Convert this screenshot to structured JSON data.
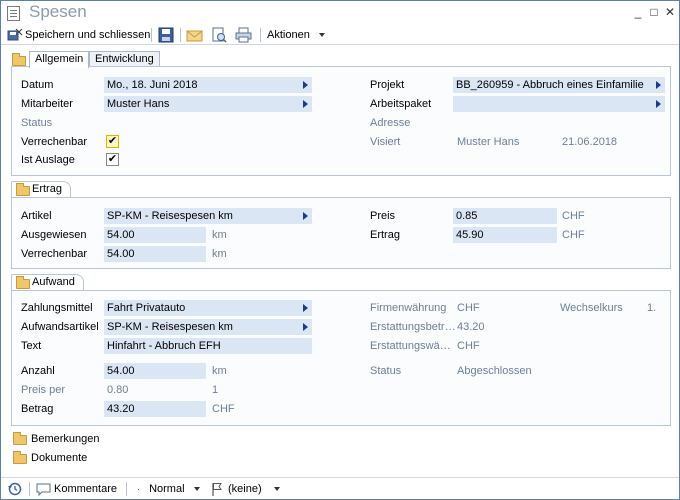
{
  "window": {
    "title": "Spesen",
    "minimize": "_",
    "maximize": "□",
    "close": "✕"
  },
  "toolbar": {
    "save_close_label": "Speichern und schliessen",
    "actions_label": "Aktionen"
  },
  "tabs": [
    {
      "label": "Allgemein",
      "active": true
    },
    {
      "label": "Entwicklung",
      "active": false
    }
  ],
  "allgemein": {
    "datum_label": "Datum",
    "datum_value": "Mo., 18. Juni 2018",
    "mitarbeiter_label": "Mitarbeiter",
    "mitarbeiter_value": "Muster Hans",
    "status_label": "Status",
    "verrechenbar_label": "Verrechenbar",
    "verrechenbar_checked": true,
    "ist_auslage_label": "Ist Auslage",
    "ist_auslage_checked": true,
    "projekt_label": "Projekt",
    "projekt_value": "BB_260959  -  Abbruch eines Einfamilie",
    "arbeitspaket_label": "Arbeitspaket",
    "arbeitspaket_value": "",
    "adresse_label": "Adresse",
    "visiert_label": "Visiert",
    "visiert_name": "Muster Hans",
    "visiert_date": "21.06.2018"
  },
  "ertrag": {
    "header": "Ertrag",
    "artikel_label": "Artikel",
    "artikel_value": "SP-KM  -  Reisespesen km",
    "ausgewiesen_label": "Ausgewiesen",
    "ausgewiesen_value": "54.00",
    "ausgewiesen_unit": "km",
    "verrechenbar_label": "Verrechenbar",
    "verrechenbar_value": "54.00",
    "verrechenbar_unit": "km",
    "preis_label": "Preis",
    "preis_value": "0.85",
    "preis_unit": "CHF",
    "ertrag_label": "Ertrag",
    "ertrag_value": "45.90",
    "ertrag_unit": "CHF"
  },
  "aufwand": {
    "header": "Aufwand",
    "zahlungsmittel_label": "Zahlungsmittel",
    "zahlungsmittel_value": "Fahrt Privatauto",
    "aufwandsartikel_label": "Aufwandsartikel",
    "aufwandsartikel_value": "SP-KM  -  Reisespesen km",
    "text_label": "Text",
    "text_value": "Hinfahrt - Abbruch EFH",
    "anzahl_label": "Anzahl",
    "anzahl_value": "54.00",
    "anzahl_unit": "km",
    "preis_per_label": "Preis per",
    "preis_per_value": "0.80",
    "preis_per_unit": "1",
    "betrag_label": "Betrag",
    "betrag_value": "43.20",
    "betrag_unit": "CHF",
    "firmenwaehrung_label": "Firmenwährung",
    "firmenwaehrung_value": "CHF",
    "wechselkurs_label": "Wechselkurs",
    "wechselkurs_value": "1.",
    "erstattungsbetrag_label": "Erstattungsbetr…",
    "erstattungsbetrag_value": "43.20",
    "erstattungswaehrung_label": "Erstattungswä…",
    "erstattungswaehrung_value": "CHF",
    "status_label": "Status",
    "status_value": "Abgeschlossen"
  },
  "sections": {
    "bemerkungen": "Bemerkungen",
    "dokumente": "Dokumente"
  },
  "statusbar": {
    "kommentare": "Kommentare",
    "priority": "Normal",
    "flag": "(keine)"
  },
  "colors": {
    "field_bg": "#dbe6f5",
    "gray_label": "#6d7f96",
    "accent_arrow": "#1a3a8c"
  }
}
